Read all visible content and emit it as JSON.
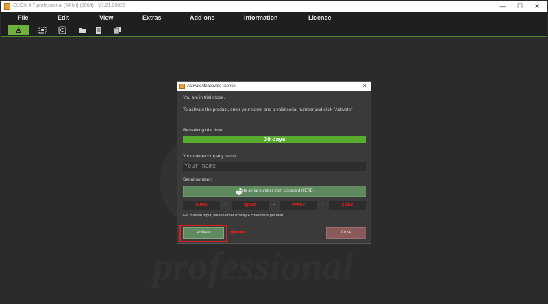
{
  "window": {
    "title": "CLICK 4.7 professional (64 bit) (1064) - V7.21.00822",
    "min_glyph": "—",
    "max_glyph": "☐",
    "close_glyph": "✕"
  },
  "menu": [
    "File",
    "Edit",
    "View",
    "Extras",
    "Add-ons",
    "Information",
    "Licence"
  ],
  "toolbar": {
    "icons": [
      "brush-icon",
      "selection-icon",
      "photo-icon",
      "folder-icon",
      "document-icon",
      "copy-icon"
    ],
    "accent": "#6fb13a"
  },
  "dialog": {
    "title": "Activate/deactivate licence",
    "close_glyph": "✕",
    "trial_mode": "You are in trial mode.",
    "instruction": "To activate the product, enter your name and a valid serial number and click \"Activate\"",
    "remaining_label": "Remaining trial time:",
    "remaining_value": "30 days",
    "name_label": "Your name/company name:",
    "name_placeholder": "Your name",
    "serial_label": "Serial number:",
    "paste_label": "Paste serial number from clipboard HERE",
    "serial_fields": [
      "50Hp",
      "qpwd",
      "wwe7",
      "spb2"
    ],
    "serial_sep": "-",
    "hint": "For manual input, please enter exactly 4 characters per field.",
    "activate_label": "Activate",
    "close_label": "Close"
  },
  "colors": {
    "trial_bar": "#58ad2e",
    "activate": "#5f8a5f",
    "close": "#8a5a5a",
    "highlight": "#e01e1e"
  }
}
